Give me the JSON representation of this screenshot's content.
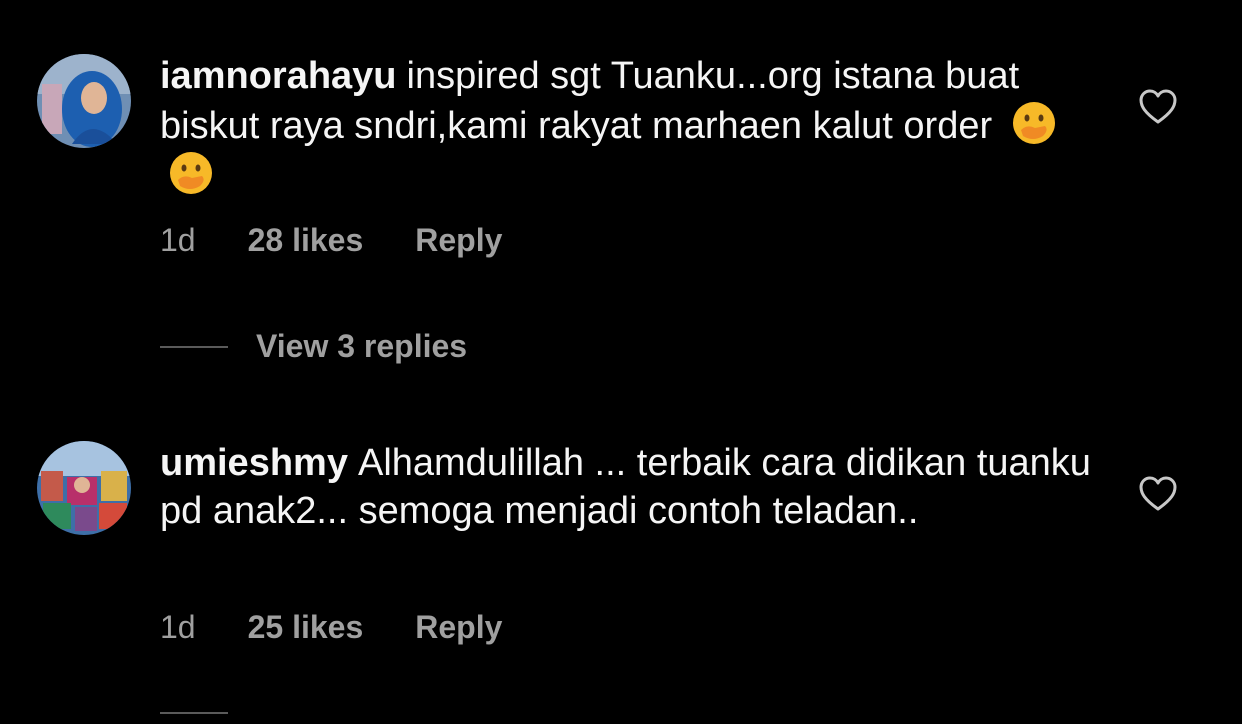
{
  "comments": [
    {
      "username": "iamnorahayu",
      "text": "inspired sgt Tuanku...org istana buat biskut raya sndri,kami rakyat marhaen kalut order",
      "emojis": [
        "face-with-hand-over-mouth",
        "face-with-hand-over-mouth"
      ],
      "time": "1d",
      "likes": "28 likes",
      "reply_label": "Reply",
      "view_replies": "View 3 replies"
    },
    {
      "username": "umieshmy",
      "text": "Alhamdulillah ... terbaik cara didikan tuanku pd anak2... semoga menjadi contoh teladan..",
      "time": "1d",
      "likes": "25 likes",
      "reply_label": "Reply"
    }
  ],
  "colors": {
    "background": "#000000",
    "text": "#f5f5f5",
    "secondary_text": "#a0a0a0",
    "emoji_yellow": "#f7b928"
  },
  "icons": [
    "avatar-photo",
    "heart-outline-icon",
    "face-with-hand-over-mouth-emoji"
  ]
}
